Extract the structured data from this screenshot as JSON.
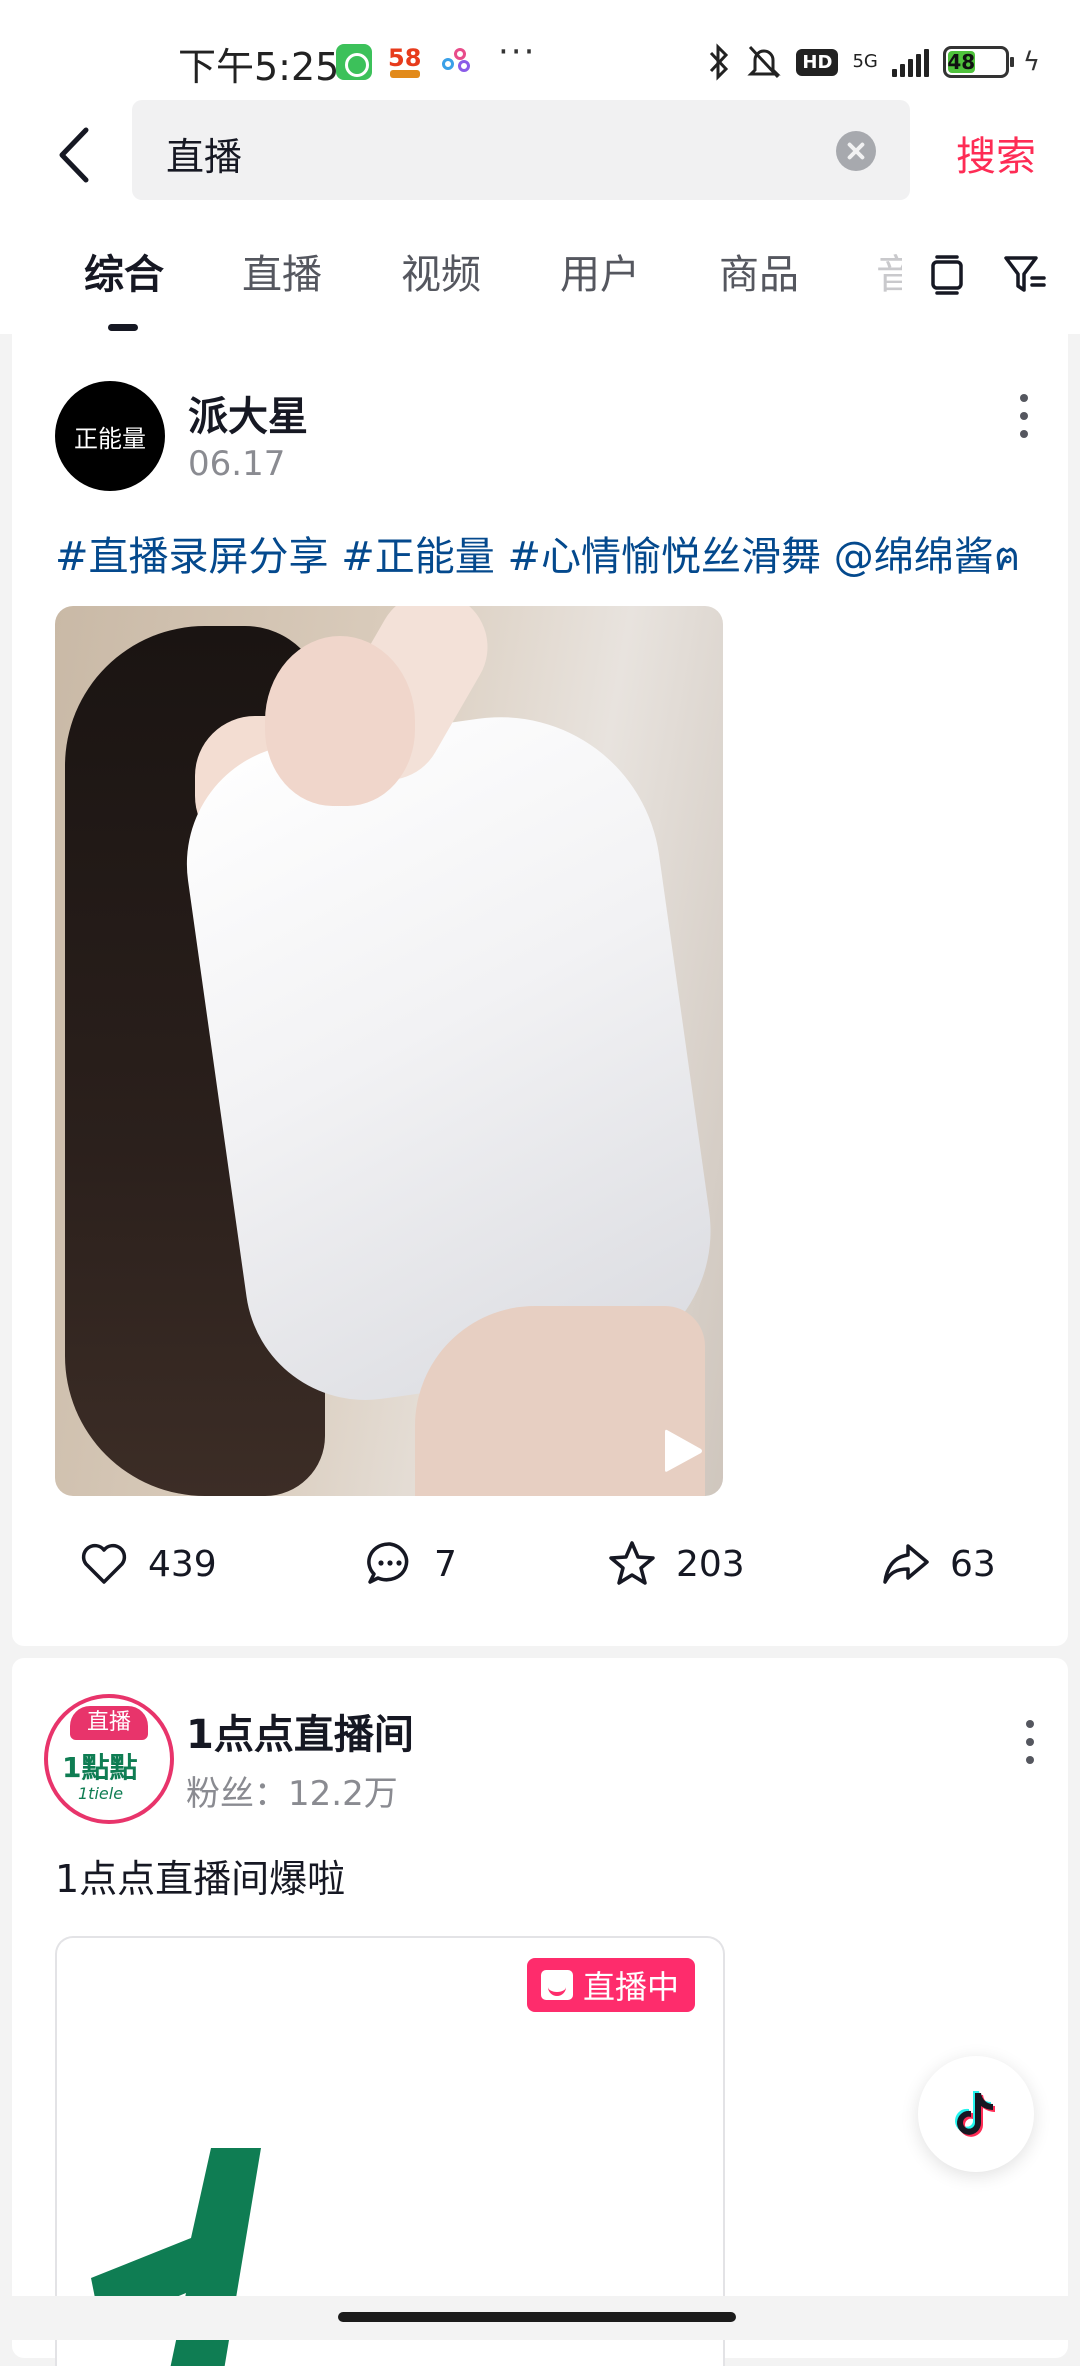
{
  "status_bar": {
    "time": "下午5:25",
    "more": "···",
    "hd": "HD",
    "network": "5G",
    "battery": "48",
    "battery_level": 0.48
  },
  "search": {
    "query": "直播",
    "submit_label": "搜索"
  },
  "tabs": [
    {
      "label": "综合",
      "active": true
    },
    {
      "label": "直播",
      "active": false
    },
    {
      "label": "视频",
      "active": false
    },
    {
      "label": "用户",
      "active": false
    },
    {
      "label": "商品",
      "active": false
    },
    {
      "label": "音",
      "active": false
    }
  ],
  "posts": [
    {
      "avatar_text": "正能量",
      "author": "派大星",
      "date": "06.17",
      "caption": "#直播录屏分享 #正能量 #心情愉悦丝滑舞 @绵绵酱ฅ",
      "actions": {
        "likes": "439",
        "comments": "7",
        "favorites": "203",
        "shares": "63"
      }
    },
    {
      "avatar_badge": "直播",
      "avatar_logo": "1點點",
      "avatar_script": "1tiele",
      "author": "1点点直播间",
      "fans": "粉丝：12.2万",
      "caption": "1点点直播间爆啦",
      "live_badge": "直播中"
    }
  ],
  "colors": {
    "accent": "#fe2c55",
    "hashtag": "#04498d",
    "live_badge": "#fe2c6c",
    "brand_green": "#0f7d53"
  },
  "icons": [
    "back-arrow-icon",
    "clear-icon",
    "layout-icon",
    "filter-icon",
    "more-icon",
    "heart-icon",
    "comment-icon",
    "star-icon",
    "share-icon",
    "play-icon",
    "shop-icon",
    "tiktok-icon"
  ]
}
